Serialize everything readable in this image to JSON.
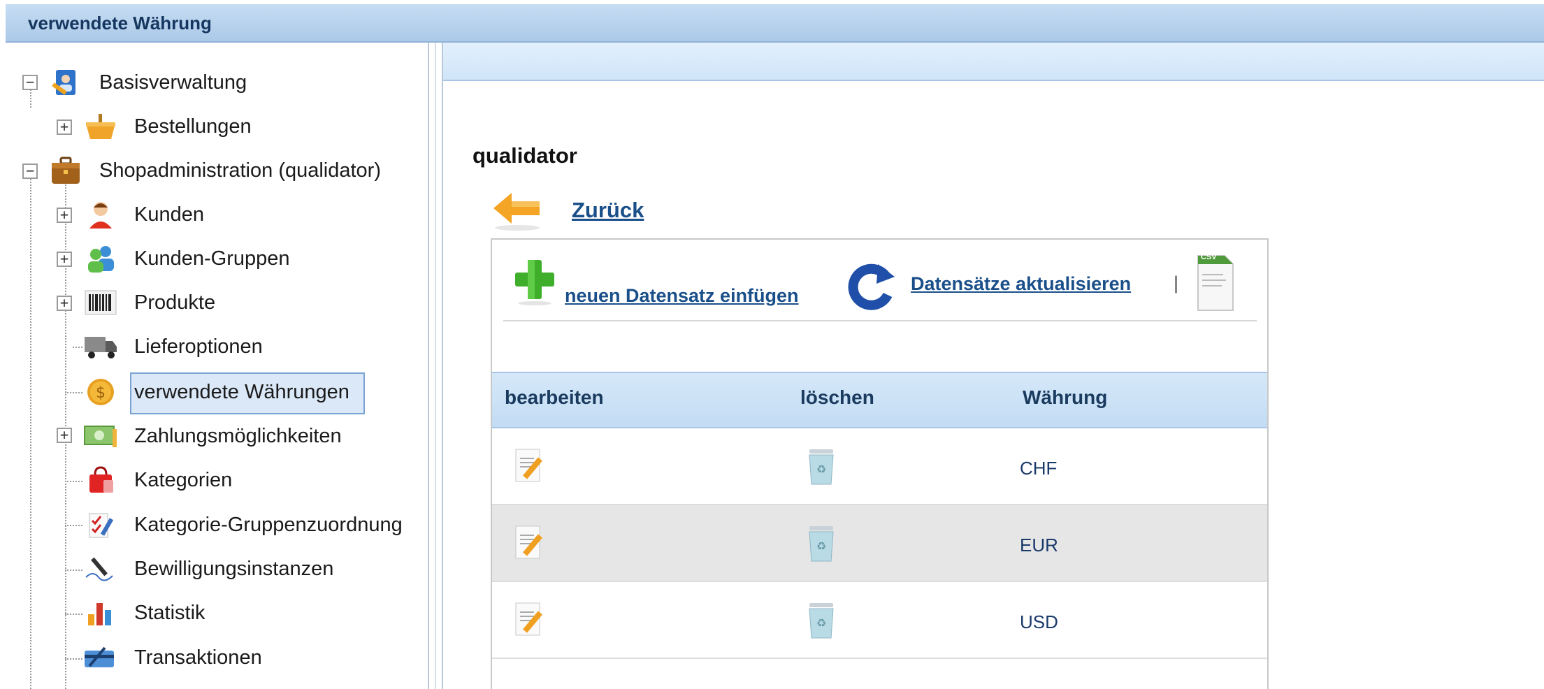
{
  "window": {
    "title": "verwendete Währung"
  },
  "sidebar": {
    "items": [
      {
        "label": "Basisverwaltung",
        "icon": "user-id-icon"
      },
      {
        "label": "Bestellungen",
        "icon": "basket-icon"
      },
      {
        "label": "Shopadministration (qualidator)",
        "icon": "briefcase-icon"
      },
      {
        "label": "Kunden",
        "icon": "customer-icon"
      },
      {
        "label": "Kunden-Gruppen",
        "icon": "customer-group-icon"
      },
      {
        "label": "Produkte",
        "icon": "barcode-icon"
      },
      {
        "label": "Lieferoptionen",
        "icon": "truck-icon"
      },
      {
        "label": "verwendete Währungen",
        "icon": "coin-icon"
      },
      {
        "label": "Zahlungsmöglichkeiten",
        "icon": "banknote-icon"
      },
      {
        "label": "Kategorien",
        "icon": "shopping-bag-icon"
      },
      {
        "label": "Kategorie-Gruppenzuordnung",
        "icon": "checklist-icon"
      },
      {
        "label": "Bewilligungsinstanzen",
        "icon": "pen-signature-icon"
      },
      {
        "label": "Statistik",
        "icon": "bar-chart-icon"
      },
      {
        "label": "Transaktionen",
        "icon": "credit-card-icon"
      }
    ]
  },
  "main": {
    "shop_title": "qualidator",
    "back_label": "Zurück",
    "toolbar": {
      "insert_label": "neuen Datensatz einfügen",
      "refresh_label": "Datensätze aktualisieren",
      "separator": "|",
      "csv_badge": "CSV"
    },
    "table": {
      "columns": [
        "bearbeiten",
        "löschen",
        "Währung"
      ],
      "rows": [
        {
          "currency": "CHF"
        },
        {
          "currency": "EUR"
        },
        {
          "currency": "USD"
        }
      ]
    }
  },
  "colors": {
    "link": "#1a4f8a",
    "header_blue": "#c3dcf3",
    "selected_bg": "#dbe8f7"
  }
}
